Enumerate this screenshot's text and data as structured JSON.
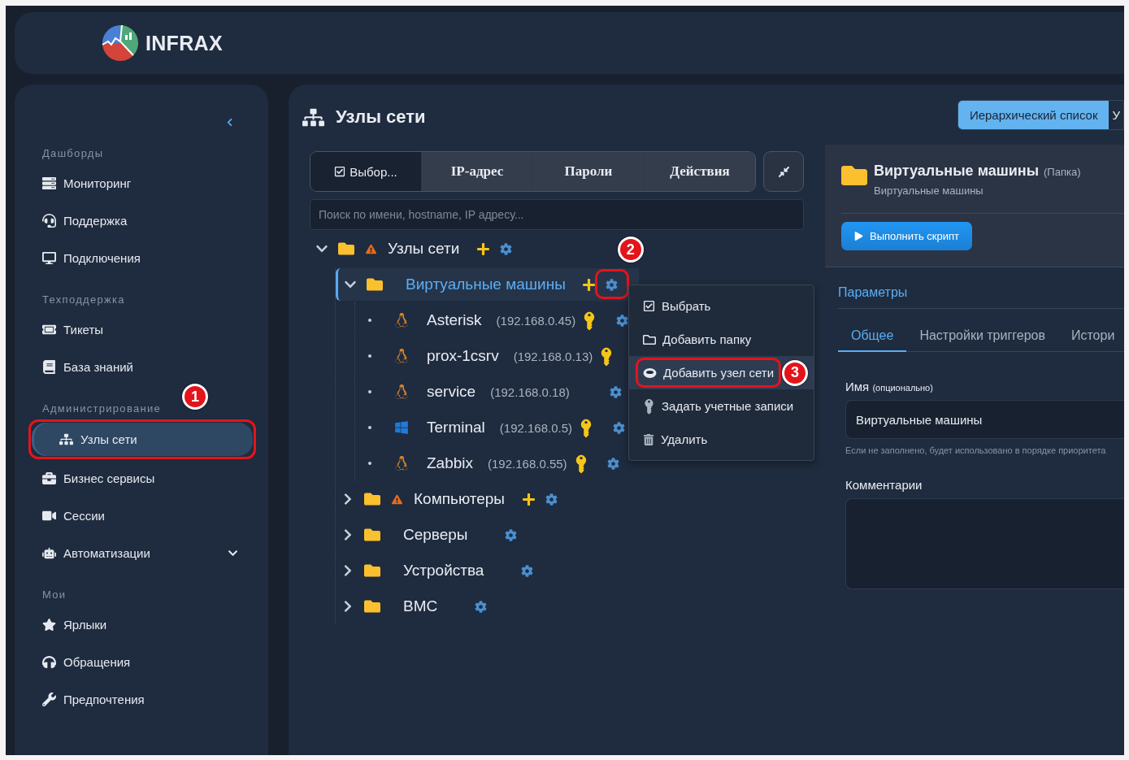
{
  "logo": {
    "name": "INFRAX"
  },
  "sidebar": {
    "sections": [
      {
        "title": "Дашборды",
        "items": [
          {
            "label": "Мониторинг",
            "selected": false
          },
          {
            "label": "Поддержка",
            "selected": false
          },
          {
            "label": "Подключения",
            "selected": false
          }
        ]
      },
      {
        "title": "Техподдержка",
        "items": [
          {
            "label": "Тикеты",
            "selected": false
          },
          {
            "label": "База знаний",
            "selected": false
          }
        ]
      },
      {
        "title": "Администрирование",
        "items": [
          {
            "label": "Узлы сети",
            "selected": true,
            "callout": "1"
          },
          {
            "label": "Бизнес сервисы",
            "selected": false
          },
          {
            "label": "Сессии",
            "selected": false
          },
          {
            "label": "Автоматизации",
            "selected": false,
            "expanded": false
          }
        ]
      },
      {
        "title": "Мои",
        "items": [
          {
            "label": "Ярлыки",
            "selected": false
          },
          {
            "label": "Обращения",
            "selected": false
          },
          {
            "label": "Предпочтения",
            "selected": false
          }
        ]
      }
    ]
  },
  "page": {
    "title": "Узлы сети",
    "views": [
      {
        "label": "Иерархический список",
        "selected": true
      },
      {
        "label": "У",
        "selected": false
      }
    ]
  },
  "toolbar": {
    "tabs": [
      {
        "label": "Выбор...",
        "kind": "checkbox",
        "selected": true
      },
      {
        "label": "IP-адрес",
        "kind": "column",
        "selected": false
      },
      {
        "label": "Пароли",
        "kind": "column",
        "selected": false
      },
      {
        "label": "Действия",
        "kind": "column",
        "selected": false
      }
    ]
  },
  "search": {
    "placeholder": "Поиск по имени, hostname, IP адресу..."
  },
  "tree": [
    {
      "kind": "folder",
      "label": "Узлы сети",
      "expanded": true,
      "warning": true,
      "add_button": true,
      "selected": false,
      "children": [
        {
          "kind": "folder",
          "label": "Виртуальные машины",
          "expanded": true,
          "warning": false,
          "add_button": true,
          "selected": true,
          "callout": "2",
          "children": [
            {
              "kind": "linux",
              "name": "Asterisk",
              "ip": "(192.168.0.45)",
              "key": true,
              "settings_button": true
            },
            {
              "kind": "linux",
              "name": "prox-1csrv",
              "ip": "(192.168.0.13)",
              "key": true,
              "settings_button": false
            },
            {
              "kind": "linux",
              "name": "service",
              "ip": "(192.168.0.18)",
              "key": false,
              "settings_button": true
            },
            {
              "kind": "windows",
              "name": "Terminal",
              "ip": "(192.168.0.5)",
              "key": true,
              "settings_button": true
            },
            {
              "kind": "linux",
              "name": "Zabbix",
              "ip": "(192.168.0.55)",
              "key": true,
              "settings_button": true
            }
          ]
        },
        {
          "kind": "folder",
          "label": "Компьютеры",
          "expanded": false,
          "warning": true,
          "add_button": true,
          "selected": false
        },
        {
          "kind": "folder",
          "label": "Серверы",
          "expanded": false,
          "warning": false,
          "add_button": false,
          "selected": false
        },
        {
          "kind": "folder",
          "label": "Устройства",
          "expanded": false,
          "warning": false,
          "add_button": false,
          "selected": false
        },
        {
          "kind": "folder",
          "label": "BMC",
          "expanded": false,
          "warning": false,
          "add_button": false,
          "selected": false
        }
      ]
    }
  ],
  "context_menu": {
    "items": [
      {
        "label": "Выбрать",
        "hovered": false
      },
      {
        "label": "Добавить папку",
        "hovered": false
      },
      {
        "label": "Добавить узел сети",
        "hovered": true,
        "callout": "3"
      },
      {
        "label": "Задать учетные записи",
        "hovered": false
      },
      {
        "label": "Удалить",
        "hovered": false
      }
    ]
  },
  "details": {
    "title": "Виртуальные машины",
    "type": "(Папка)",
    "subtitle": "Виртуальные машины",
    "run_button": "Выполнить скрипт",
    "section_tabs": [
      {
        "label": "Параметры",
        "selected": true
      }
    ],
    "tabs": [
      {
        "label": "Общее",
        "selected": true
      },
      {
        "label": "Настройки триггеров",
        "selected": false
      },
      {
        "label": "Истори",
        "selected": false
      }
    ],
    "name_field": {
      "label": "Имя",
      "note": "(опционально)",
      "value": "Виртуальные машины",
      "hint": "Если не заполнено, будет использовано в порядке приоритета"
    },
    "comments": {
      "label": "Комментарии"
    }
  }
}
